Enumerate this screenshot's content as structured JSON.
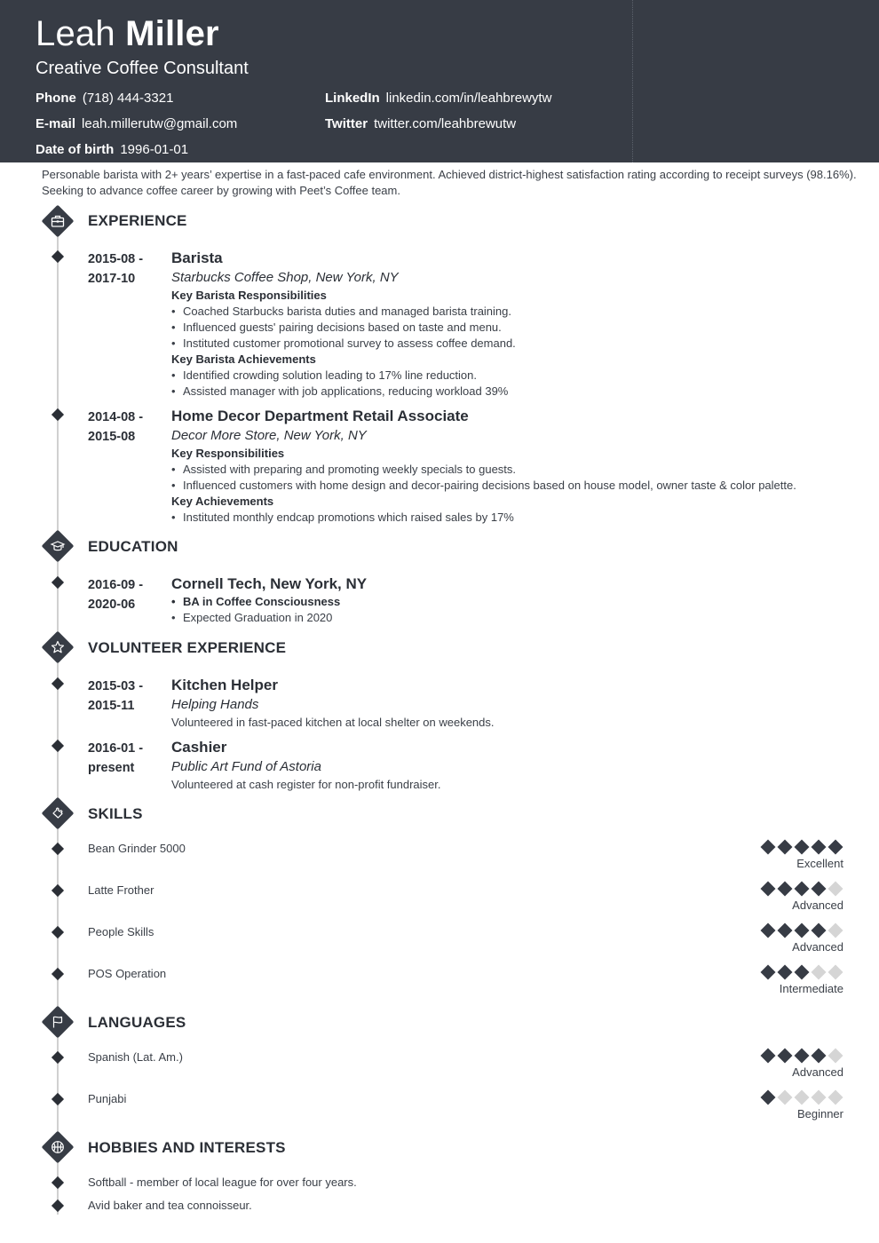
{
  "header": {
    "first_name": "Leah",
    "last_name": "Miller",
    "title": "Creative Coffee Consultant",
    "contacts": [
      {
        "label": "Phone",
        "value": "(718) 444-3321"
      },
      {
        "label": "E-mail",
        "value": "leah.millerutw@gmail.com"
      },
      {
        "label": "Date of birth",
        "value": "1996-01-01"
      },
      {
        "label": "LinkedIn",
        "value": "linkedin.com/in/leahbrewytw"
      },
      {
        "label": "Twitter",
        "value": "twitter.com/leahbrewutw"
      }
    ]
  },
  "summary": "Personable barista with 2+ years’ expertise in a fast-paced cafe environment. Achieved district-highest satisfaction rating according to receipt surveys (98.16%). Seeking to advance coffee career by growing with Peet’s Coffee team.",
  "sections": {
    "experience": {
      "title": "EXPERIENCE",
      "icon": "briefcase-icon",
      "entries": [
        {
          "date_start": "2015-08 -",
          "date_end": "2017-10",
          "role": "Barista",
          "org": "Starbucks Coffee Shop, New York, NY",
          "groups": [
            {
              "heading": "Key Barista Responsibilities",
              "items": [
                "Coached Starbucks barista duties and managed barista training.",
                "Influenced guests' pairing decisions based on taste and menu.",
                "Instituted customer promotional survey to assess coffee demand."
              ]
            },
            {
              "heading": "Key Barista Achievements",
              "items": [
                "Identified crowding solution leading to 17% line reduction.",
                "Assisted manager with job applications, reducing workload 39%"
              ]
            }
          ]
        },
        {
          "date_start": "2014-08 -",
          "date_end": "2015-08",
          "role": "Home Decor Department Retail Associate",
          "org": "Decor More Store, New York, NY",
          "groups": [
            {
              "heading": "Key Responsibilities",
              "items": [
                "Assisted with preparing and promoting weekly specials to guests.",
                "Influenced customers with home design and decor-pairing decisions based on house model, owner taste & color palette."
              ]
            },
            {
              "heading": "Key Achievements",
              "items": [
                "Instituted monthly endcap promotions which raised sales by 17%"
              ]
            }
          ]
        }
      ]
    },
    "education": {
      "title": "EDUCATION",
      "icon": "graduation-cap-icon",
      "entries": [
        {
          "date_start": "2016-09 -",
          "date_end": "2020-06",
          "school": "Cornell Tech, New York, NY",
          "items": [
            "BA in Coffee Consciousness",
            "Expected Graduation in 2020"
          ]
        }
      ]
    },
    "volunteer": {
      "title": "VOLUNTEER EXPERIENCE",
      "icon": "star-icon",
      "entries": [
        {
          "date_start": "2015-03 -",
          "date_end": "2015-11",
          "role": "Kitchen Helper",
          "org": "Helping Hands",
          "desc": "Volunteered in fast-paced kitchen at local shelter on weekends."
        },
        {
          "date_start": "2016-01 -",
          "date_end": "present",
          "role": "Cashier",
          "org": "Public Art Fund of Astoria",
          "desc": "Volunteered at cash register for non-profit fundraiser."
        }
      ]
    },
    "skills": {
      "title": "SKILLS",
      "icon": "puzzle-piece-icon",
      "items": [
        {
          "name": "Bean Grinder 5000",
          "level": 5,
          "max": 5,
          "label": "Excellent"
        },
        {
          "name": "Latte Frother",
          "level": 4,
          "max": 5,
          "label": "Advanced"
        },
        {
          "name": "People Skills",
          "level": 4,
          "max": 5,
          "label": "Advanced"
        },
        {
          "name": "POS Operation",
          "level": 3,
          "max": 5,
          "label": "Intermediate"
        }
      ]
    },
    "languages": {
      "title": "LANGUAGES",
      "icon": "flag-icon",
      "items": [
        {
          "name": "Spanish (Lat. Am.)",
          "level": 4,
          "max": 5,
          "label": "Advanced"
        },
        {
          "name": "Punjabi",
          "level": 1,
          "max": 5,
          "label": "Beginner"
        }
      ]
    },
    "hobbies": {
      "title": "HOBBIES AND INTERESTS",
      "icon": "basketball-icon",
      "items": [
        "Softball - member of local league for over four years.",
        "Avid baker and tea connoisseur."
      ]
    }
  },
  "colors": {
    "header_bg": "#373c45",
    "accent": "#373c45",
    "rating_off": "#d5d5d5",
    "timeline": "#d0d0d0"
  }
}
